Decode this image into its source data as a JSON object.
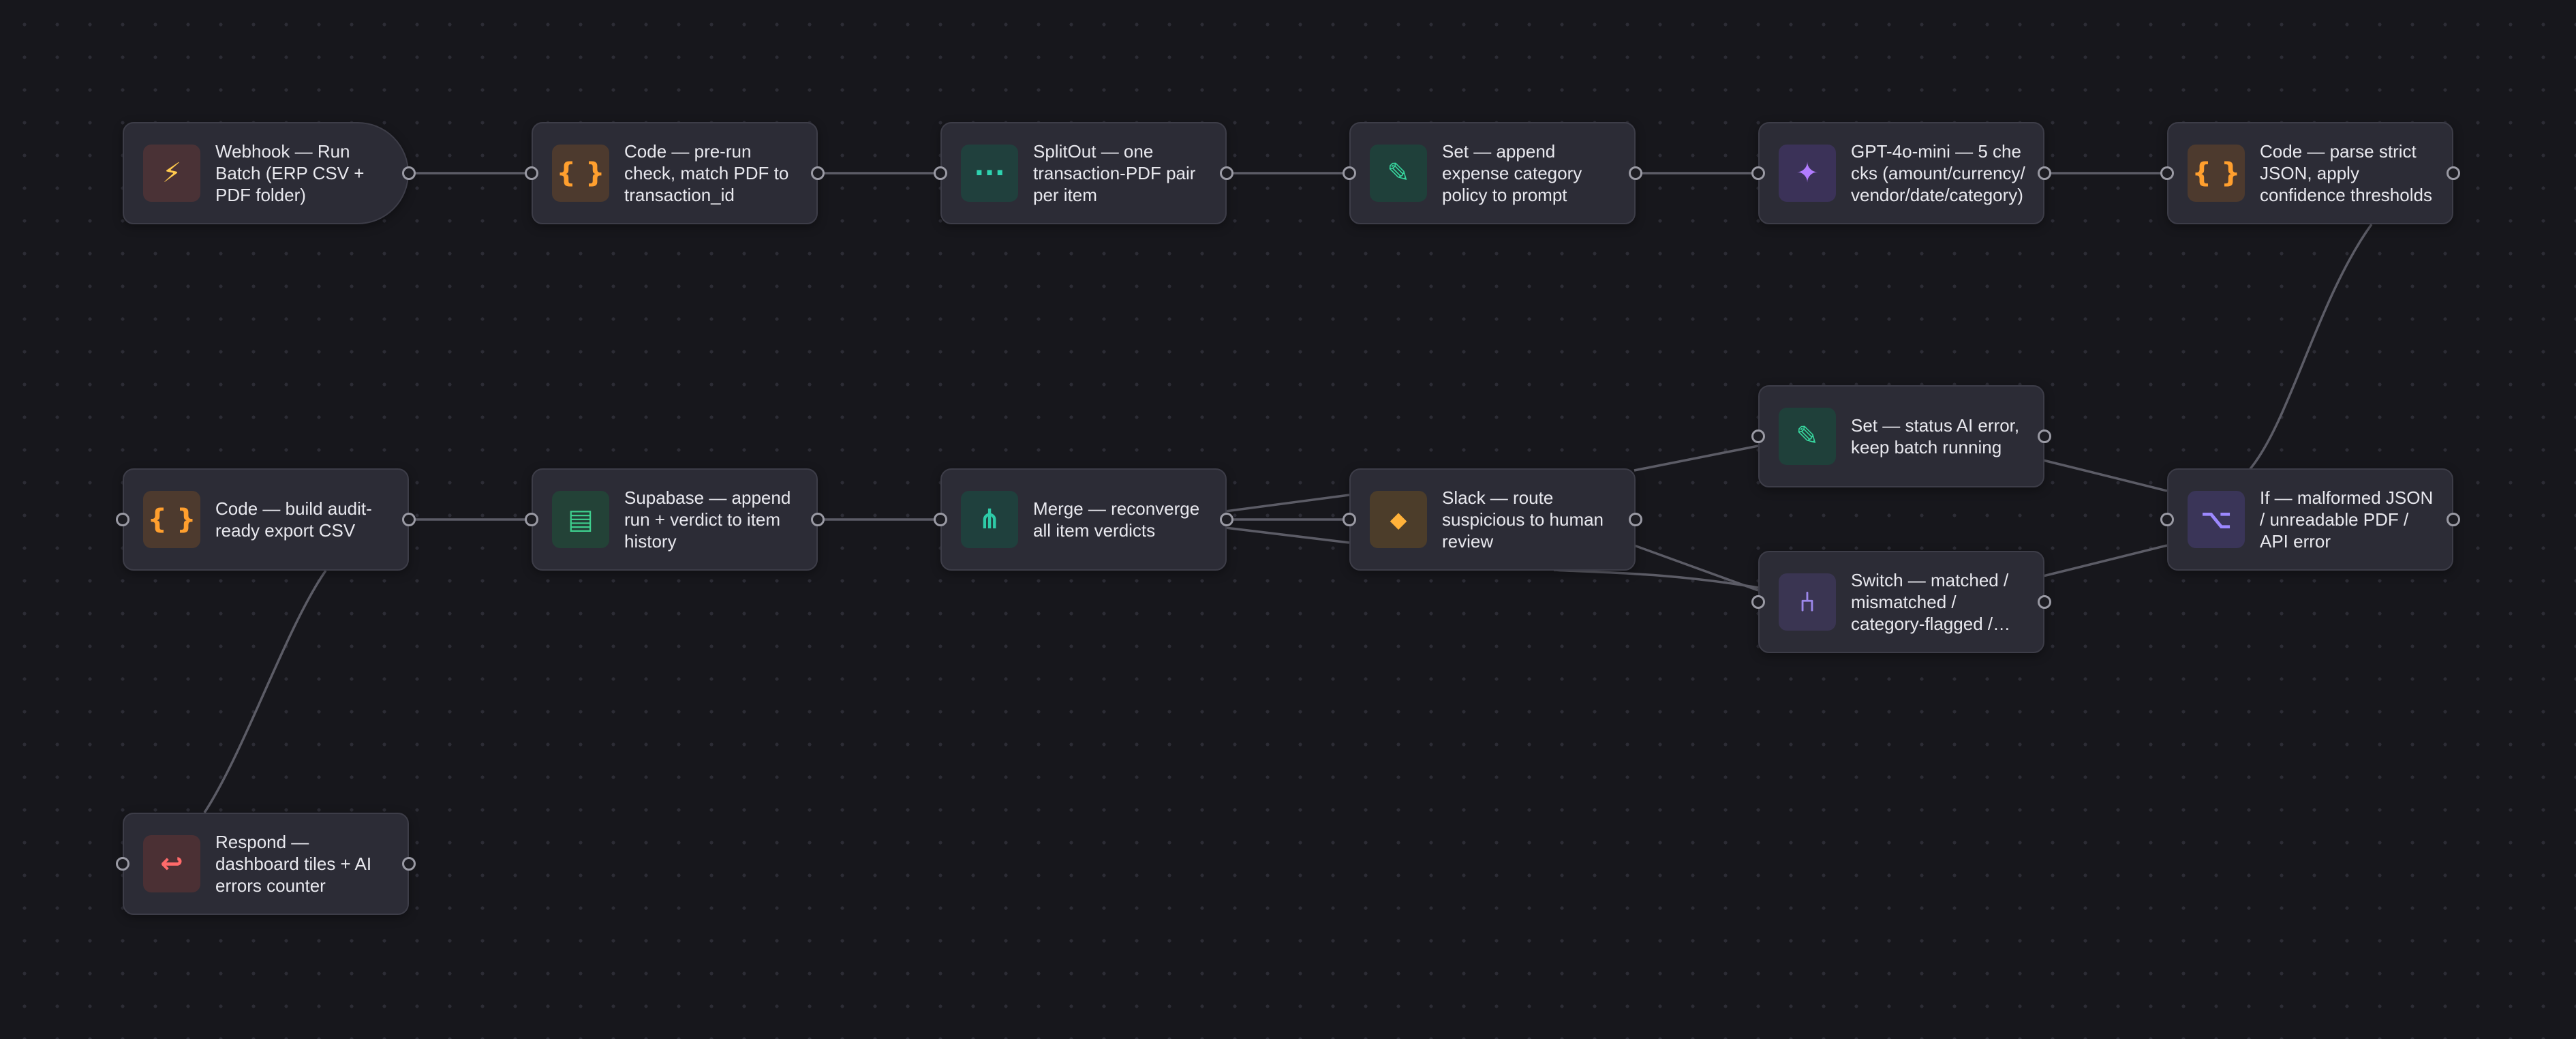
{
  "colors": {
    "background": "#17171c",
    "node_fill": "#2c2c36",
    "edge": "#5c5c66"
  },
  "nodes": [
    {
      "id": "webhook",
      "label": "Webhook — Run Batch (ERP CSV + PDF folder)",
      "icon": "lightning-icon",
      "glyph": "⚡"
    },
    {
      "id": "code-prerun",
      "label": "Code — pre-run check, match PDF to transaction_id",
      "icon": "code-braces-icon",
      "glyph": "{ }"
    },
    {
      "id": "splitout",
      "label": "SplitOut — one transaction-PDF pair per item",
      "icon": "split-dots-icon",
      "glyph": "···"
    },
    {
      "id": "set-append",
      "label": "Set — append expense category policy to prompt",
      "icon": "pencil-icon",
      "glyph": "✎"
    },
    {
      "id": "gpt",
      "label": "GPT-4o-mini — 5 checks (amount/currency/vendor/date/category)",
      "icon": "sparkle-icon",
      "glyph": "✦"
    },
    {
      "id": "code-parse",
      "label": "Code — parse strict JSON, apply confidence thresholds",
      "icon": "code-braces-icon",
      "glyph": "{ }"
    },
    {
      "id": "set-status",
      "label": "Set — status AI error, keep batch running",
      "icon": "pencil-icon",
      "glyph": "✎"
    },
    {
      "id": "if-malformed",
      "label": "If — malformed JSON / unreadable PDF / API error",
      "icon": "branch-if-icon",
      "glyph": "⌥"
    },
    {
      "id": "switch",
      "label": "Switch — matched / mismatched / category-flagged / suspicious",
      "icon": "switch-fork-icon",
      "glyph": "⑃"
    },
    {
      "id": "slack",
      "label": "Slack — route suspicious to human review",
      "icon": "diamond-icon",
      "glyph": "◆"
    },
    {
      "id": "merge",
      "label": "Merge — reconverge all item verdicts",
      "icon": "merge-icon",
      "glyph": "⋔"
    },
    {
      "id": "supabase",
      "label": "Supabase — append run + verdict to item history",
      "icon": "database-table-icon",
      "glyph": "▤"
    },
    {
      "id": "code-export",
      "label": "Code — build audit-ready export CSV",
      "icon": "code-braces-icon",
      "glyph": "{ }"
    },
    {
      "id": "respond",
      "label": "Respond — dashboard tiles + AI errors counter",
      "icon": "return-arrow-icon",
      "glyph": "↩"
    }
  ]
}
